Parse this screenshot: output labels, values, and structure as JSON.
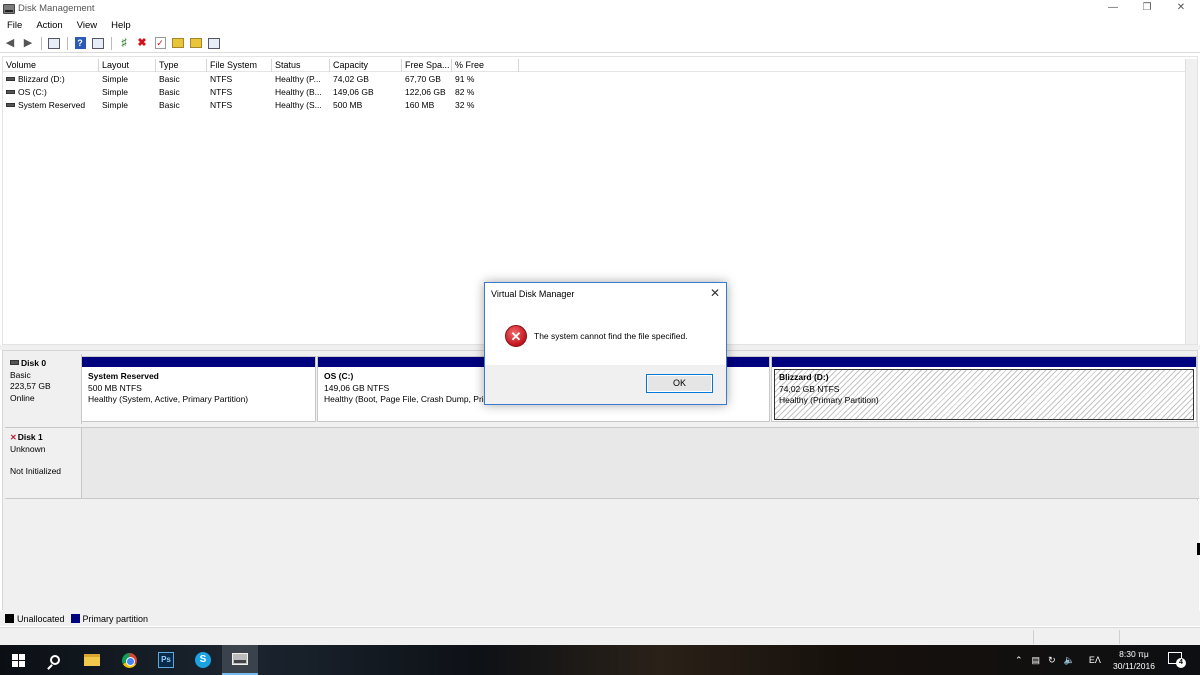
{
  "window": {
    "title": "Disk Management",
    "minimize_glyph": "—",
    "restore_glyph": "❐",
    "close_glyph": "✕"
  },
  "menu": [
    "File",
    "Action",
    "View",
    "Help"
  ],
  "toolbar": {
    "icons": [
      "back-arrow-icon",
      "forward-arrow-icon",
      "console-tree-icon",
      "help-icon",
      "properties-icon",
      "connect-icon",
      "delete-icon",
      "check-icon",
      "open-folder-icon",
      "explore-icon",
      "settings-icon"
    ]
  },
  "volume_list": {
    "columns": [
      "Volume",
      "Layout",
      "Type",
      "File System",
      "Status",
      "Capacity",
      "Free Spa...",
      "% Free"
    ],
    "rows": [
      [
        "Blizzard (D:)",
        "Simple",
        "Basic",
        "NTFS",
        "Healthy (P...",
        "74,02 GB",
        "67,70 GB",
        "91 %"
      ],
      [
        "OS (C:)",
        "Simple",
        "Basic",
        "NTFS",
        "Healthy (B...",
        "149,06 GB",
        "122,06 GB",
        "82 %"
      ],
      [
        "System Reserved",
        "Simple",
        "Basic",
        "NTFS",
        "Healthy (S...",
        "500 MB",
        "160 MB",
        "32 %"
      ]
    ]
  },
  "disks": {
    "disk0": {
      "name": "Disk 0",
      "type": "Basic",
      "size": "223,57 GB",
      "state": "Online",
      "partitions": [
        {
          "name": "System Reserved",
          "size": "500 MB NTFS",
          "status": "Healthy (System, Active, Primary Partition)"
        },
        {
          "name": "OS  (C:)",
          "size": "149,06 GB NTFS",
          "status": "Healthy (Boot, Page File, Crash Dump, Pri"
        },
        {
          "name": "Blizzard  (D:)",
          "size": "74,02 GB NTFS",
          "status": "Healthy (Primary Partition)"
        }
      ]
    },
    "disk1": {
      "name": "Disk 1",
      "type": "Unknown",
      "state": "Not Initialized"
    }
  },
  "legend": {
    "unallocated": "Unallocated",
    "primary": "Primary partition",
    "colors": {
      "unallocated": "#000000",
      "primary": "#00027e"
    }
  },
  "dialog": {
    "title": "Virtual Disk Manager",
    "message": "The system cannot find the file specified.",
    "ok_label": "OK",
    "error_glyph": "✕",
    "close_glyph": "✕"
  },
  "taskbar": {
    "apps": [
      "start-icon",
      "search-icon",
      "file-explorer-icon",
      "chrome-icon",
      "photoshop-icon",
      "skype-icon",
      "disk-management-icon"
    ],
    "photoshop_label": "Ps",
    "skype_label": "S",
    "tray": {
      "language": "EΛ",
      "time": "8:30 πμ",
      "date": "30/11/2016",
      "notifications": "4"
    }
  }
}
